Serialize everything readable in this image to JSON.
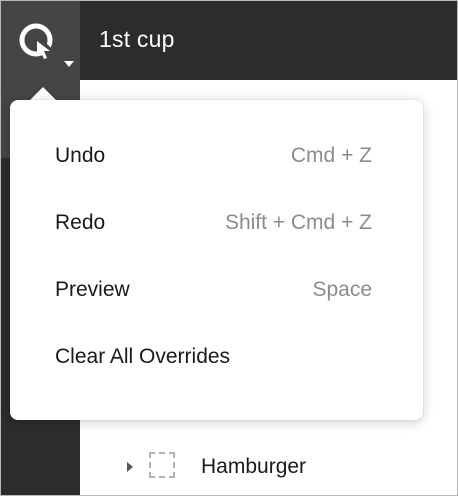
{
  "header": {
    "title": "1st cup",
    "app_menu_icon": "figma-logo-icon"
  },
  "menu": {
    "items": [
      {
        "label": "Undo",
        "shortcut": "Cmd + Z"
      },
      {
        "label": "Redo",
        "shortcut": "Shift + Cmd + Z"
      },
      {
        "label": "Preview",
        "shortcut": "Space"
      },
      {
        "label": "Clear All Overrides",
        "shortcut": ""
      }
    ]
  },
  "layers": {
    "items": [
      {
        "label": "Hamburger",
        "icon": "frame-icon"
      }
    ]
  },
  "colors": {
    "topbar": "#2c2c2c",
    "menu_button": "#454545",
    "shortcut_text": "#8c8c8c"
  }
}
